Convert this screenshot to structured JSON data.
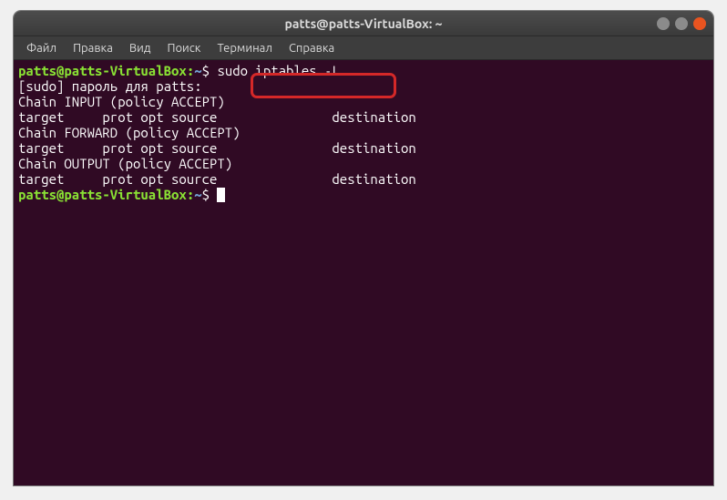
{
  "window": {
    "title": "patts@patts-VirtualBox: ~"
  },
  "menu": {
    "items": [
      "Файл",
      "Правка",
      "Вид",
      "Поиск",
      "Терминал",
      "Справка"
    ]
  },
  "prompt": {
    "user_host": "patts@patts-VirtualBox",
    "colon": ":",
    "path": "~",
    "dollar": "$ "
  },
  "terminal": {
    "command1": "sudo iptables -L",
    "lines": [
      "[sudo] пароль для patts: ",
      "Chain INPUT (policy ACCEPT)",
      "target     prot opt source               destination         ",
      "",
      "Chain FORWARD (policy ACCEPT)",
      "target     prot opt source               destination         ",
      "",
      "Chain OUTPUT (policy ACCEPT)",
      "target     prot opt source               destination         "
    ]
  }
}
